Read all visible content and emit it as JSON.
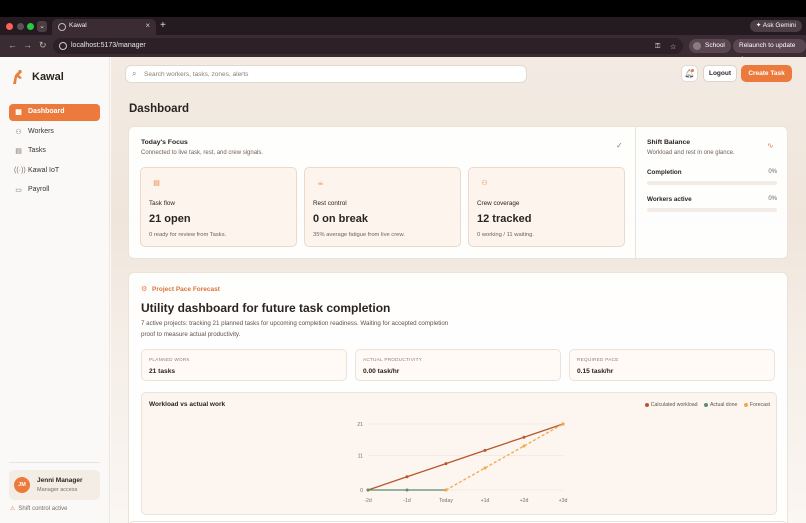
{
  "browser": {
    "tab_title": "Kawal",
    "url": "localhost:5173/manager",
    "ask_gemini": "Ask Gemini",
    "profile_label": "School",
    "relaunch_label": "Relaunch to update"
  },
  "app": {
    "brand": "Kawal",
    "nav": [
      {
        "label": "Dashboard",
        "icon": "dashboard-icon",
        "active": true
      },
      {
        "label": "Workers",
        "icon": "users-icon",
        "active": false
      },
      {
        "label": "Tasks",
        "icon": "clipboard-icon",
        "active": false
      },
      {
        "label": "Kawal IoT",
        "icon": "signal-icon",
        "active": false
      },
      {
        "label": "Payroll",
        "icon": "wallet-icon",
        "active": false
      }
    ],
    "user": {
      "initials": "JM",
      "name": "Jenni Manager",
      "role": "Manager access"
    },
    "shift_status": "Shift control active",
    "accent_color": "#ec7a3c"
  },
  "topbar": {
    "search_placeholder": "Search workers, tasks, zones, alerts",
    "logout_label": "Logout",
    "create_task_label": "Create Task"
  },
  "page_title": "Dashboard",
  "focus": {
    "title": "Today's Focus",
    "subtitle": "Connected to live task, rest, and crew signals.",
    "cards": [
      {
        "icon": "clipboard-icon",
        "label": "Task flow",
        "value": "21 open",
        "note": "0 ready for review from Tasks."
      },
      {
        "icon": "coffee-icon",
        "label": "Rest control",
        "value": "0 on break",
        "note": "35% average fatigue from live crew."
      },
      {
        "icon": "users-icon",
        "label": "Crew coverage",
        "value": "12 tracked",
        "note": "0 working / 11 waiting."
      }
    ]
  },
  "shift_balance": {
    "title": "Shift Balance",
    "subtitle": "Workload and rest in one glance.",
    "metrics": [
      {
        "label": "Completion",
        "value": "0%",
        "fraction": 0
      },
      {
        "label": "Workers active",
        "value": "0%",
        "fraction": 0
      }
    ]
  },
  "forecast": {
    "tag": "Project Pace Forecast",
    "title": "Utility dashboard for future task completion",
    "description": "7 active projects: tracking 21 planned tasks for upcoming completion readiness. Waiting for accepted completion proof to measure actual productivity.",
    "stats": [
      {
        "label": "PLANNED WORK",
        "value": "21 tasks"
      },
      {
        "label": "ACTUAL PRODUCTIVITY",
        "value": "0.00 task/hr"
      },
      {
        "label": "REQUIRED PACE",
        "value": "0.15 task/hr"
      }
    ]
  },
  "chart_data": {
    "type": "line",
    "title": "Workload vs actual work",
    "categories": [
      "-2d",
      "-1d",
      "Today",
      "+1d",
      "+2d",
      "+3d"
    ],
    "y_ticks": [
      0,
      11,
      21
    ],
    "ylim": [
      0,
      21
    ],
    "legend_position": "top-right",
    "series": [
      {
        "name": "Calculated workload",
        "color": "#b9562c",
        "dashed": false,
        "values": [
          0,
          4.2,
          8.4,
          12.6,
          16.8,
          21
        ]
      },
      {
        "name": "Actual done",
        "color": "#5e8e6a",
        "dashed": false,
        "values": [
          0,
          0,
          0,
          null,
          null,
          null
        ]
      },
      {
        "name": "Forecast",
        "color": "#f0a94a",
        "dashed": true,
        "values": [
          null,
          null,
          0,
          7,
          14,
          21
        ]
      }
    ]
  }
}
